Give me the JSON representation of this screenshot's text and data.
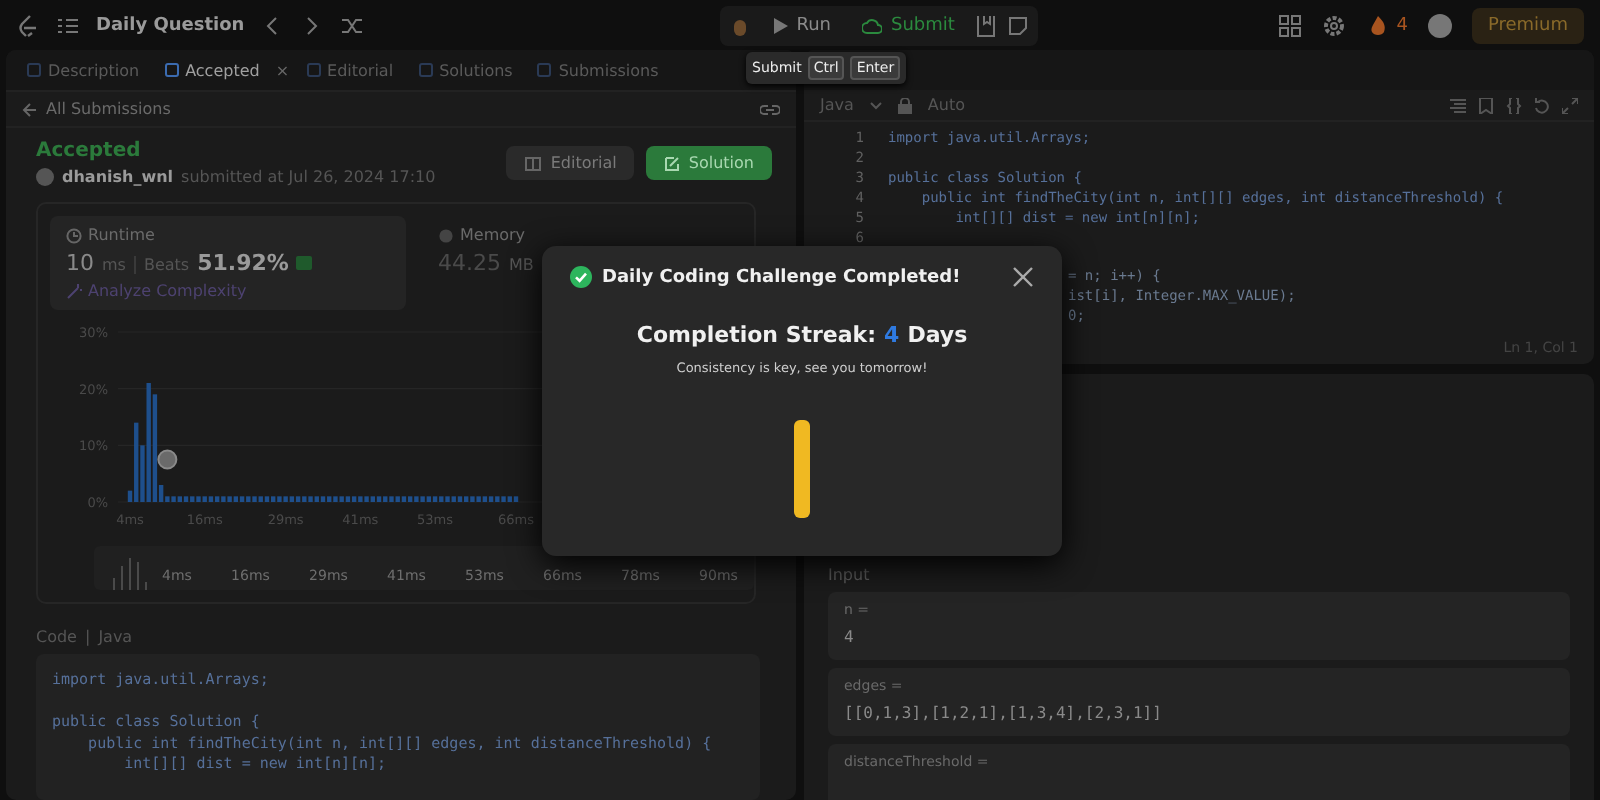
{
  "topbar": {
    "title": "Daily Question",
    "run": "Run",
    "submit": "Submit",
    "streak": "4",
    "premium": "Premium"
  },
  "tooltip": {
    "label": "Submit",
    "keys": [
      "Ctrl",
      "Enter"
    ]
  },
  "tabs": [
    {
      "label": "Description",
      "selected": false
    },
    {
      "label": "Accepted",
      "selected": true,
      "close": "×"
    },
    {
      "label": "Editorial",
      "selected": false
    },
    {
      "label": "Solutions",
      "selected": false
    },
    {
      "label": "Submissions",
      "selected": false
    }
  ],
  "submission": {
    "back": "All Submissions",
    "status": "Accepted",
    "user": "dhanish_wnl",
    "submitted": "submitted at Jul 26, 2024 17:10",
    "buttons": [
      "Editorial",
      "Solution"
    ],
    "runtime": {
      "title": "Runtime",
      "value": "10",
      "unit": "ms",
      "beats": "Beats",
      "percent": "51.92%",
      "analyze": "Analyze Complexity"
    },
    "memory": {
      "title": "Memory",
      "value": "44.25",
      "unit": "MB"
    },
    "chart_data": {
      "type": "bar",
      "x": [
        4,
        5,
        6,
        7,
        8,
        9,
        10,
        11,
        12,
        13,
        14,
        15,
        16,
        17,
        18,
        19,
        20,
        21,
        22,
        23,
        24,
        25,
        26,
        27,
        28,
        29,
        30,
        31,
        32,
        33,
        34,
        35,
        36,
        37,
        38,
        39,
        40,
        41,
        42,
        43,
        44,
        45,
        46,
        47,
        48,
        49,
        50,
        51,
        52,
        53,
        54,
        55,
        56,
        57,
        58,
        59,
        60,
        61,
        62,
        63,
        64,
        65,
        66
      ],
      "values": [
        2,
        14,
        10,
        21,
        19,
        3,
        1,
        1,
        1,
        1,
        1,
        1,
        1,
        1,
        1,
        1,
        1,
        1,
        1,
        1,
        1,
        1,
        1,
        1,
        1,
        1,
        1,
        1,
        1,
        1,
        1,
        1,
        1,
        1,
        1,
        1,
        1,
        1,
        1,
        1,
        1,
        1,
        1,
        1,
        1,
        1,
        1,
        1,
        1,
        1,
        1,
        1,
        1,
        1,
        1,
        1,
        1,
        1,
        1,
        1,
        1,
        1,
        1
      ],
      "xlim": [
        4,
        66
      ],
      "ylim": [
        0,
        30
      ],
      "yticks": [
        {
          "value": 0,
          "label": "0%"
        },
        {
          "value": 10,
          "label": "10%"
        },
        {
          "value": 20,
          "label": "20%"
        },
        {
          "value": 30,
          "label": "30%"
        }
      ],
      "xticks": [
        {
          "value": 4,
          "label": "4ms"
        },
        {
          "value": 16,
          "label": "16ms"
        },
        {
          "value": 29,
          "label": "29ms"
        },
        {
          "value": 41,
          "label": "41ms"
        },
        {
          "value": 53,
          "label": "53ms"
        },
        {
          "value": 66,
          "label": "66ms"
        }
      ]
    },
    "range_labels": [
      "4ms",
      "16ms",
      "29ms",
      "41ms",
      "53ms",
      "66ms",
      "78ms",
      "90ms"
    ],
    "code_title": "Code",
    "code_separator": "|",
    "code_lang": "Java",
    "code": [
      {
        "kind": "text",
        "text": "import java.util.Arrays;"
      },
      {
        "kind": "blank"
      },
      {
        "text": "public class Solution {"
      },
      {
        "text": "    public int findTheCity(int n, int[][] edges, int distanceThreshold) {"
      },
      {
        "text": "        int[][] dist = new int[n][n];"
      }
    ]
  },
  "editor": {
    "language": "Java",
    "mode": "Auto",
    "lines": [
      {
        "num": "1",
        "text": "import java.util.Arrays;"
      },
      {
        "num": "2"
      },
      {
        "num": "3",
        "text": "public class Solution {"
      },
      {
        "num": "4",
        "text": "    public int findTheCity(int n, int[][] edges, int distanceThreshold) {"
      },
      {
        "num": "5",
        "text": "        int[][] dist = new int[n][n];"
      },
      {
        "num": "6"
      }
    ],
    "hidden_lines": [
      "= n; i++) {",
      "ist[i], Integer.MAX_VALUE);",
      "0;"
    ],
    "position": "Ln 1, Col 1"
  },
  "testcase": {
    "heading": "Input",
    "params": [
      {
        "name": "n =",
        "value": "4"
      },
      {
        "name": "edges =",
        "value": "[[0,1,3],[1,2,1],[1,3,4],[2,3,1]]"
      },
      {
        "name": "distanceThreshold ="
      }
    ]
  },
  "modal": {
    "title": "Daily Coding Challenge Completed!",
    "streak_label": "Completion Streak:",
    "streak_count": "4",
    "streak_unit": "Days",
    "message": "Consistency is key, see you tomorrow!"
  }
}
